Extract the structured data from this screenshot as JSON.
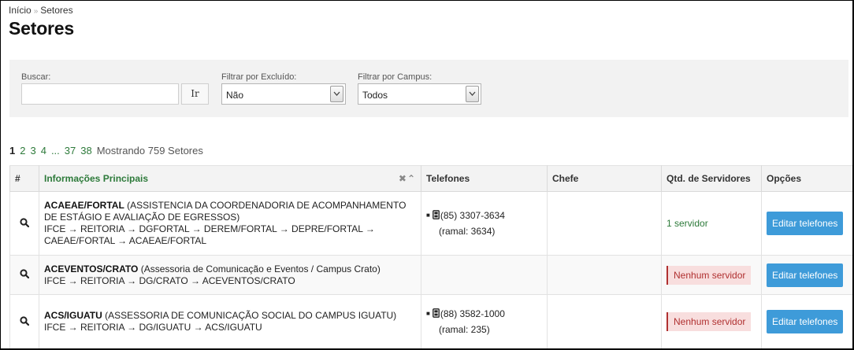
{
  "breadcrumb": {
    "home": "Início",
    "separator": "»",
    "current": "Setores"
  },
  "page_title": "Setores",
  "filters": {
    "search_label": "Buscar:",
    "search_value": "",
    "go_label": "Ir",
    "deleted_label": "Filtrar por Excluído:",
    "deleted_value": "Não",
    "campus_label": "Filtrar por Campus:",
    "campus_value": "Todos"
  },
  "pagination": {
    "pages": [
      "1",
      "2",
      "3",
      "4"
    ],
    "ellipsis": "...",
    "near_last": "37",
    "last": "38",
    "summary": "Mostrando 759 Setores"
  },
  "table": {
    "headers": {
      "hash": "#",
      "main": "Informações Principais",
      "sort_icons": "✖︎⌃",
      "phones": "Telefones",
      "chief": "Chefe",
      "count": "Qtd. de Servidores",
      "options": "Opções"
    },
    "rows": [
      {
        "sigla": "ACAEAE/FORTAL",
        "name": "(ASSISTENCIA DA COORDENADORIA DE ACOMPANHAMENTO DE ESTÁGIO E AVALIAÇÃO DE EGRESSOS)",
        "hierarchy_1": "IFCE → REITORIA → DGFORTAL → DEREM/FORTAL → DEPRE/FORTAL →",
        "hierarchy_2": "CAEAE/FORTAL → ACAEAE/FORTAL",
        "phone": "(85) 3307-3634",
        "ramal": "(ramal: 3634)",
        "servers": "1 servidor",
        "action": "Editar telefones"
      },
      {
        "sigla": "ACEVENTOS/CRATO",
        "name": "(Assessoria de Comunicação e Eventos / Campus Crato)",
        "hierarchy_1": "IFCE → REITORIA → DG/CRATO → ACEVENTOS/CRATO",
        "servers": "Nenhum servidor",
        "action": "Editar telefones"
      },
      {
        "sigla": "ACS/IGUATU",
        "name": "(ASSESSORIA DE COMUNICAÇÃO SOCIAL DO CAMPUS IGUATU)",
        "hierarchy_1": "IFCE → REITORIA → DG/IGUATU → ACS/IGUATU",
        "phone": "(88) 3582-1000",
        "ramal": "(ramal: 235)",
        "servers": "Nenhum servidor",
        "action": "Editar telefones"
      }
    ]
  },
  "icons": {
    "row_detail": "magnifier-icon",
    "phone": "phone-icon",
    "select_arrow": "chevron-down-icon"
  },
  "colors": {
    "link_green": "#2d7a3a",
    "button_blue": "#3e9bd9",
    "badge_red": "#b03030",
    "badge_bg": "#f8dede",
    "filter_bg": "#f2f2f2"
  }
}
